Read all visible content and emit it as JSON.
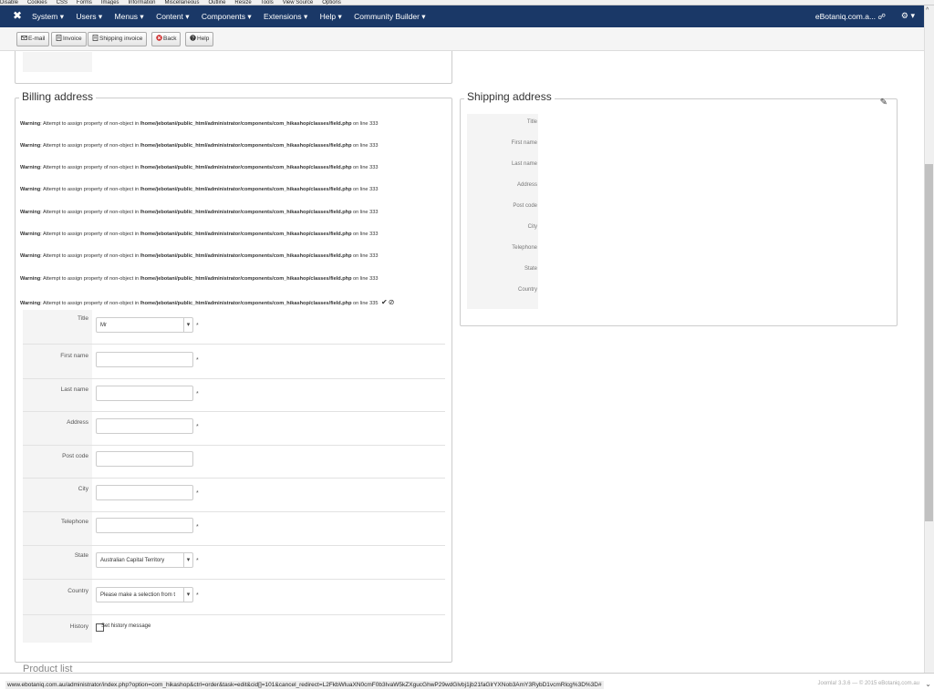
{
  "devbar": {
    "items": [
      "Disable",
      "Cookies",
      "CSS",
      "Forms",
      "Images",
      "Information",
      "Miscellaneous",
      "Outline",
      "Resize",
      "Tools",
      "View Source",
      "Options"
    ]
  },
  "navbar": {
    "menu": [
      "System ▾",
      "Users ▾",
      "Menus ▾",
      "Content ▾",
      "Components ▾",
      "Extensions ▾",
      "Help ▾",
      "Community Builder ▾"
    ],
    "site": "eBotaniq.com.a... ☍",
    "gear": "⚙ ▾"
  },
  "toolbar": {
    "email": "E-mail",
    "invoice": "Invoice",
    "shipping_invoice": "Shipping invoice",
    "back": "Back",
    "help": "Help"
  },
  "billing": {
    "legend": "Billing address",
    "warning_prefix": "Warning",
    "warning_text": ": Attempt to assign property of non-object in ",
    "warning_path": "/home/jebotani/public_html/administrator/components/com_hikashop/classes/field.php",
    "warning_line": " on line 333",
    "warning_line_last": " on line 335",
    "fields": {
      "title_label": "Title",
      "title_value": "Mr",
      "firstname_label": "First name",
      "lastname_label": "Last name",
      "address_label": "Address",
      "postcode_label": "Post code",
      "city_label": "City",
      "telephone_label": "Telephone",
      "state_label": "State",
      "state_value": "Australian Capital Territory",
      "country_label": "Country",
      "country_value": "Please make a selection from t",
      "history_label": "History",
      "history_text": "Set history message"
    },
    "required_mark": "*"
  },
  "shipping": {
    "legend": "Shipping address",
    "labels": [
      "Title",
      "First name",
      "Last name",
      "Address",
      "Post code",
      "City",
      "Telephone",
      "State",
      "Country"
    ]
  },
  "product_list": {
    "legend": "Product list"
  },
  "status": {
    "url": "www.ebotaniq.com.au/administrator/index.php?option=com_hikashop&ctrl=order&task=edit&cid[]=101&cancel_redirect=L2FkbWluaXN0cmF0b3IvaW5kZXgucGhwP29wdGlvbj1jb21faGlrYXNob3AmY3RybD1vcmRlcg%3D%3D#",
    "copyright": "Joomla! 3.3.6 — © 2015 eBotaniq.com.au"
  },
  "colors": {
    "navbar": "#1a3867",
    "back_icon": "#cc2222"
  }
}
